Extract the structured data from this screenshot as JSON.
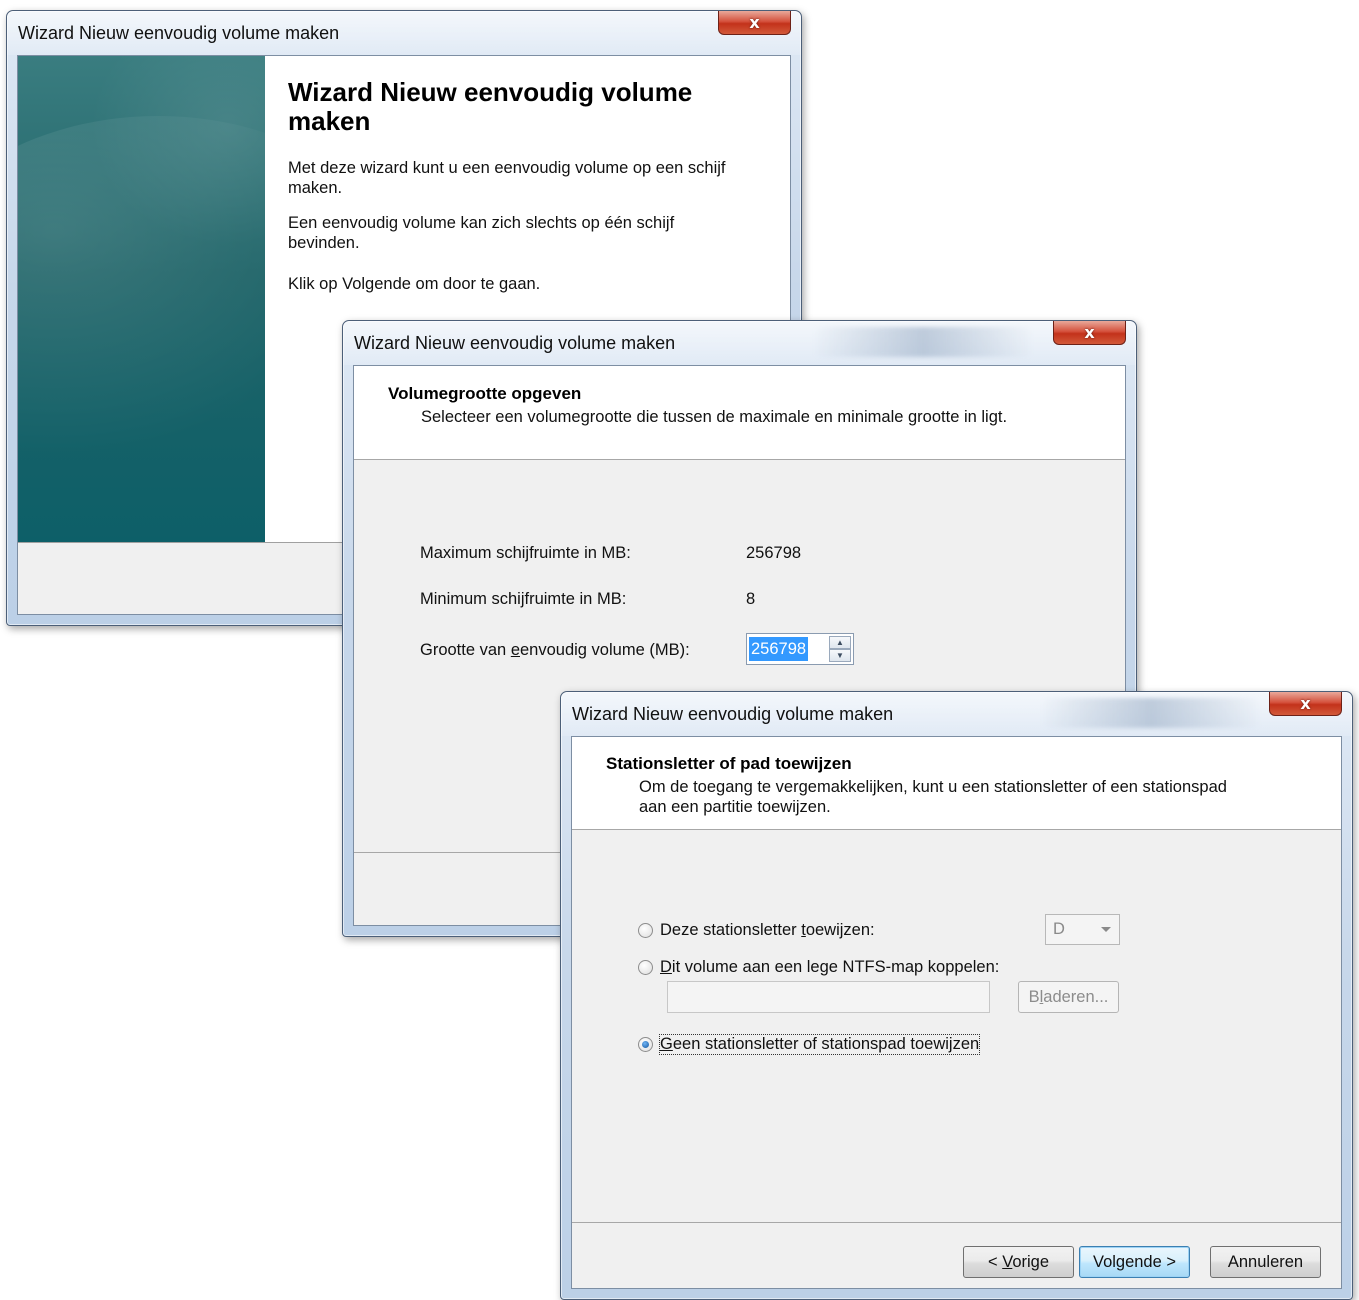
{
  "window1": {
    "title": "Wizard Nieuw eenvoudig volume maken",
    "close_label": "x",
    "heading": "Wizard Nieuw eenvoudig volume maken",
    "para1": "Met deze wizard kunt u een eenvoudig volume op een schijf maken.",
    "para2": "Een eenvoudig volume kan zich slechts op één schijf bevinden.",
    "para3": "Klik op Volgende om door te gaan."
  },
  "window2": {
    "title": "Wizard Nieuw eenvoudig volume maken",
    "close_label": "x",
    "header_title": "Volumegrootte opgeven",
    "header_subtitle": "Selecteer een volumegrootte die tussen de maximale en minimale grootte in ligt.",
    "max_label": "Maximum schijfruimte in MB:",
    "max_value": "256798",
    "min_label": "Minimum schijfruimte in MB:",
    "min_value": "8",
    "size_label_pre": "Grootte van ",
    "size_label_accel": "e",
    "size_label_post": "envoudig volume (MB):",
    "size_value": "256798"
  },
  "window3": {
    "title": "Wizard Nieuw eenvoudig volume maken",
    "close_label": "x",
    "header_title": "Stationsletter of pad toewijzen",
    "header_subtitle": "Om de toegang te vergemakkelijken, kunt u een stationsletter of een stationspad aan een partitie toewijzen.",
    "option1_pre": "Deze stationsletter ",
    "option1_accel": "t",
    "option1_post": "oewijzen:",
    "drive_letter": "D",
    "option2_accel": "D",
    "option2_post": "it volume aan een lege NTFS-map koppelen:",
    "browse_pre": "B",
    "browse_accel": "l",
    "browse_post": "aderen...",
    "option3_accel": "G",
    "option3_post": "een stationsletter of stationspad toewijzen",
    "selected_option": 3,
    "back_pre": "< ",
    "back_accel": "V",
    "back_post": "orige",
    "next_label": "Volgende >",
    "cancel_label": "Annuleren"
  }
}
